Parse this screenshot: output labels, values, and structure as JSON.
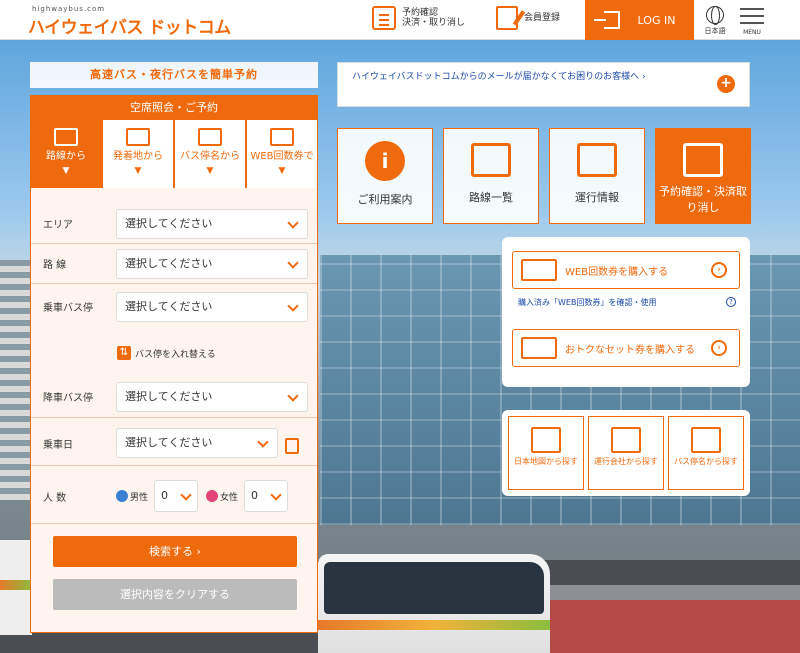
{
  "header": {
    "logo_sub": "highwaybus.com",
    "logo": "ハイウェイバス ドットコム",
    "reservation_line1": "予約確認",
    "reservation_line2": "決済・取り消し",
    "register": "会員登録",
    "login": "LOG IN",
    "lang": "日本語",
    "menu": "MENU"
  },
  "form": {
    "tagline": "高速バス・夜行バスを簡単予約",
    "panel_title": "空席照会・ご予約",
    "tabs": [
      "路線から",
      "発着地から",
      "バス停名から",
      "WEB回数券で"
    ],
    "tab_arrow": "▼",
    "rows": {
      "area": {
        "label": "エリア",
        "value": "選択してください"
      },
      "route": {
        "label": "路 線",
        "value": "選択してください"
      },
      "board": {
        "label": "乗車バス停",
        "value": "選択してください"
      },
      "alight": {
        "label": "降車バス停",
        "value": "選択してください"
      },
      "date": {
        "label": "乗車日",
        "value": "選択してください"
      },
      "people": {
        "label": "人 数"
      }
    },
    "swap": "バス停を入れ替える",
    "male": "男性",
    "female": "女性",
    "male_count": "0",
    "female_count": "0",
    "search": "検索する ›",
    "clear": "選択内容をクリアする"
  },
  "notice": {
    "text": "ハイウェイバスドットコムからのメールが届かなくてお困りのお客様へ ›",
    "plus": "+"
  },
  "tiles": [
    {
      "label": "ご利用案内",
      "icon": "info-icon",
      "glyph": "i"
    },
    {
      "label": "路線一覧",
      "icon": "map-icon"
    },
    {
      "label": "運行情報",
      "icon": "bus-alert-icon"
    },
    {
      "label": "予約確認・決済取り消し",
      "icon": "list-icon"
    }
  ],
  "web": {
    "buy_ticket": "WEB回数券を購入する",
    "confirm_link": "購入済み「WEB回数券」を確認・使用",
    "set_ticket": "おトクなセット券を購入する",
    "arrow": "›",
    "help": "?"
  },
  "find": [
    {
      "label": "日本地図から探す"
    },
    {
      "label": "運行会社から探す"
    },
    {
      "label": "バス停名から探す"
    }
  ],
  "colors": {
    "accent": "#ef6a0c",
    "link": "#1a4aa8"
  }
}
